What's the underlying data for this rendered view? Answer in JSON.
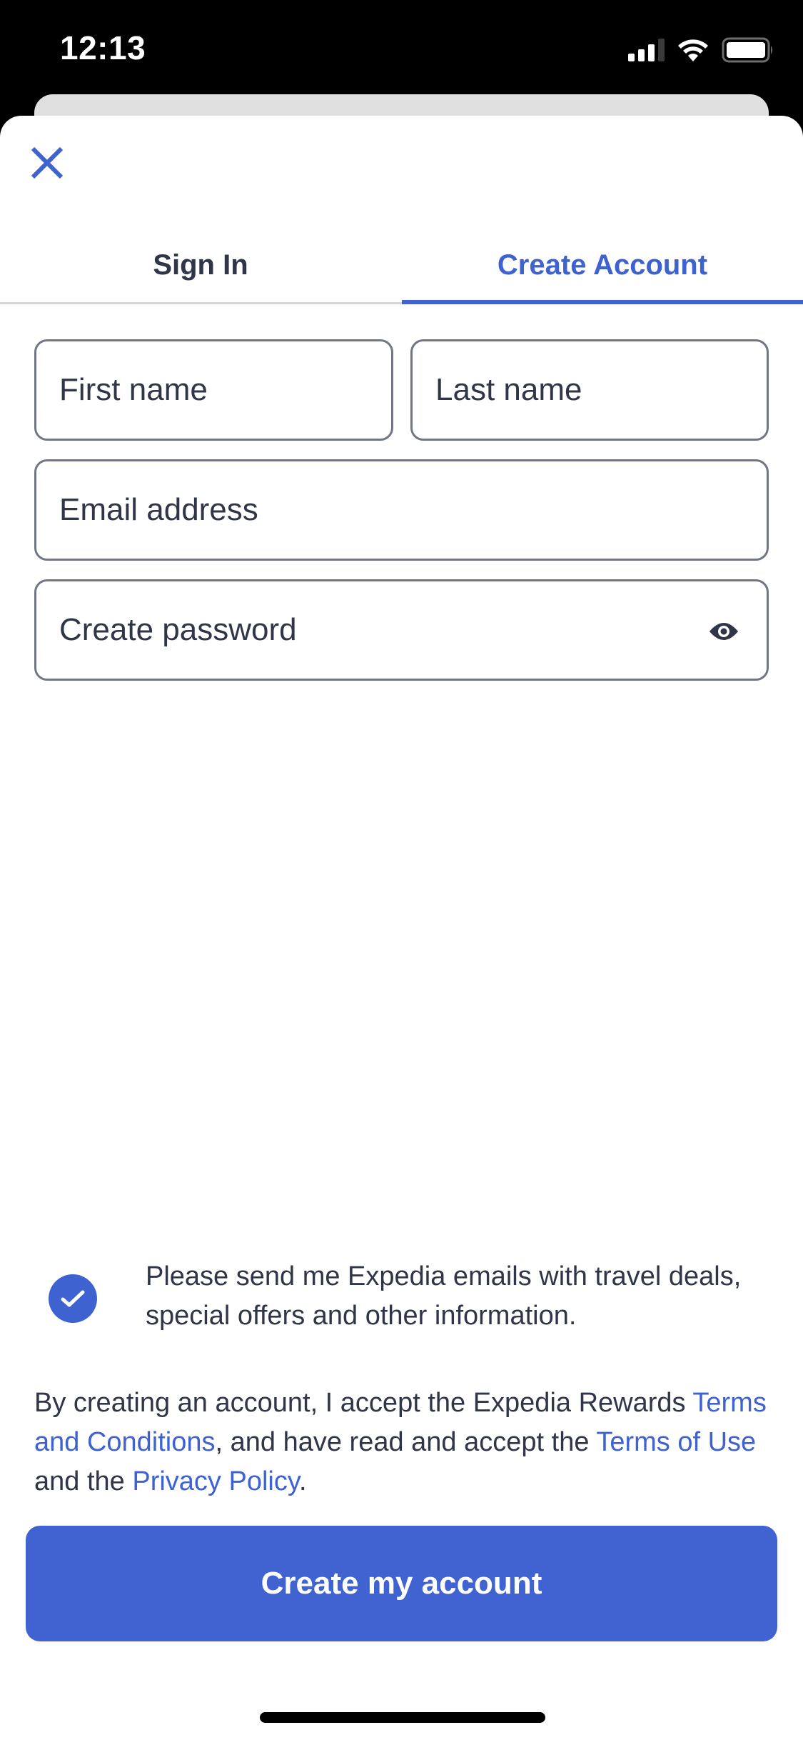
{
  "status_bar": {
    "time": "12:13",
    "signal_bars_active": 3,
    "signal_bars_total": 4,
    "icons": [
      "signal-icon",
      "wifi-icon",
      "battery-icon"
    ]
  },
  "header": {
    "close_icon": "close-icon",
    "close_label": "Close"
  },
  "tabs": [
    {
      "label": "Sign In",
      "selected": false
    },
    {
      "label": "Create Account",
      "selected": true
    }
  ],
  "form": {
    "first_name": {
      "value": "",
      "placeholder": "First name"
    },
    "last_name": {
      "value": "",
      "placeholder": "Last name"
    },
    "email": {
      "value": "",
      "placeholder": "Email address"
    },
    "password": {
      "value": "",
      "placeholder": "Create password",
      "toggle_icon": "eye-icon"
    }
  },
  "optin": {
    "checked": true,
    "text": "Please send me Expedia emails with travel deals, special offers and other information."
  },
  "legal": {
    "part1": "By creating an account, I accept the Expedia Rewards ",
    "link_terms_conditions": "Terms and Conditions",
    "part2": ", and have read and accept the ",
    "link_terms_of_use": "Terms of Use",
    "part3": " and the ",
    "link_privacy": "Privacy Policy",
    "part4": "."
  },
  "cta": {
    "label": "Create my account"
  },
  "colors": {
    "accent": "#3f62d1",
    "text": "#303548",
    "field_border": "#727584",
    "divider": "#d6d5d5"
  }
}
